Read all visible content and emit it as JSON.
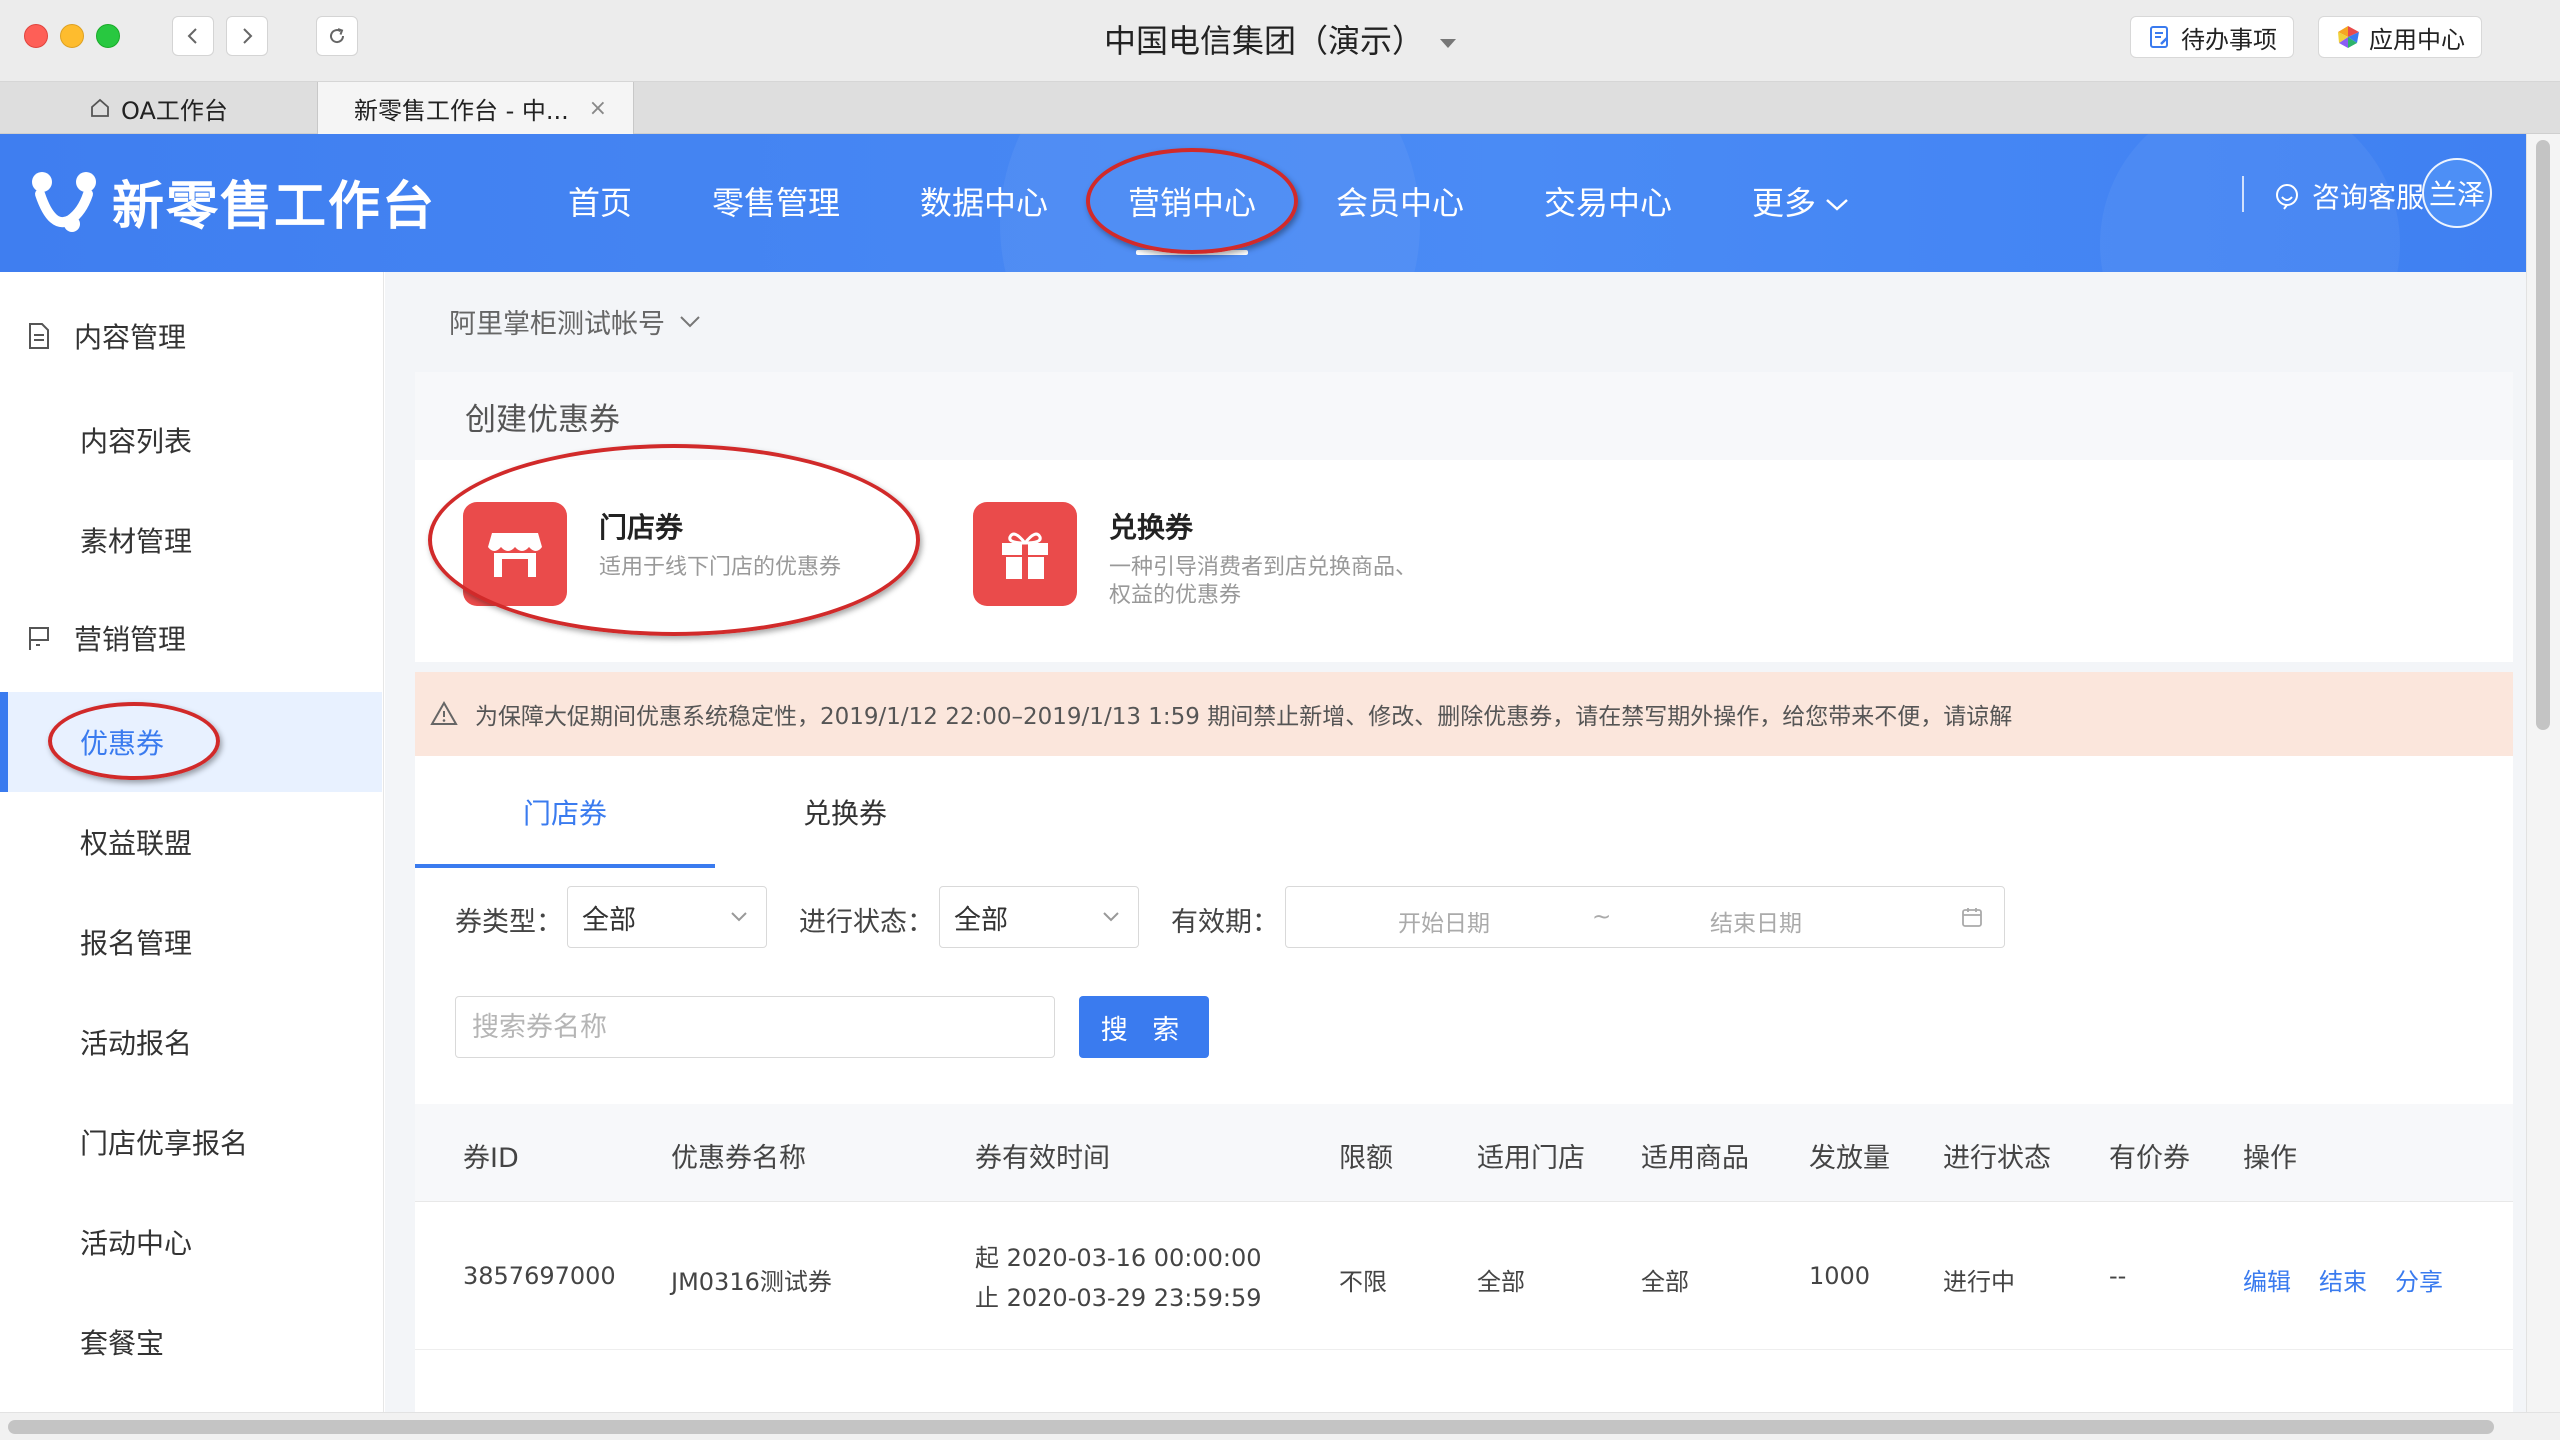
{
  "window": {
    "title": "中国电信集团（演示）",
    "todo_label": "待办事项",
    "apps_label": "应用中心"
  },
  "browser_tabs": [
    {
      "label": "OA工作台"
    },
    {
      "label": "新零售工作台 - 中...",
      "close": "×"
    }
  ],
  "header": {
    "logo_text": "新零售工作台",
    "nav": [
      "首页",
      "零售管理",
      "数据中心",
      "营销中心",
      "会员中心",
      "交易中心",
      "更多"
    ],
    "active_nav": "营销中心",
    "consult_label": "咨询客服",
    "avatar_text": "兰泽"
  },
  "sidebar": {
    "group1": "内容管理",
    "items1": [
      "内容列表",
      "素材管理"
    ],
    "group2": "营销管理",
    "items2": [
      "优惠券",
      "权益联盟",
      "报名管理",
      "活动报名",
      "门店优享报名",
      "活动中心",
      "套餐宝"
    ],
    "active": "优惠券"
  },
  "main": {
    "account": "阿里掌柜测试帐号",
    "create_title": "创建优惠券",
    "store_coupon": {
      "title": "门店券",
      "desc": "适用于线下门店的优惠券"
    },
    "exchange_coupon": {
      "title": "兑换券",
      "desc_line1": "一种引导消费者到店兑换商品、",
      "desc_line2": "权益的优惠券"
    },
    "notice": "为保障大促期间优惠系统稳定性，2019/1/12 22:00–2019/1/13 1:59 期间禁止新增、修改、删除优惠券，请在禁写期外操作，给您带来不便，请谅解",
    "tabs": [
      "门店券",
      "兑换券"
    ],
    "filters": {
      "type_label": "券类型：",
      "type_value": "全部",
      "status_label": "进行状态：",
      "status_value": "全部",
      "validity_label": "有效期：",
      "start_placeholder": "开始日期",
      "separator": "~",
      "end_placeholder": "结束日期",
      "search_placeholder": "搜索券名称",
      "search_button": "搜 索"
    },
    "table": {
      "headers": [
        "券ID",
        "优惠券名称",
        "券有效时间",
        "限额",
        "适用门店",
        "适用商品",
        "发放量",
        "进行状态",
        "有价券",
        "操作"
      ],
      "rows": [
        {
          "id": "3857697000",
          "name": "JM0316测试券",
          "time_start": "起 2020-03-16 00:00:00",
          "time_end": "止 2020-03-29 23:59:59",
          "limit": "不限",
          "stores": "全部",
          "goods": "全部",
          "quantity": "1000",
          "status": "进行中",
          "valued": "--",
          "actions": [
            "编辑",
            "结束",
            "分享"
          ]
        }
      ]
    }
  },
  "colors": {
    "brand_blue": "#3f7ef0",
    "accent": "#3a7bef",
    "coupon_red": "#ea4b4b",
    "notice_bg": "#fbe6dc",
    "annotation_red": "#d12a2a"
  }
}
